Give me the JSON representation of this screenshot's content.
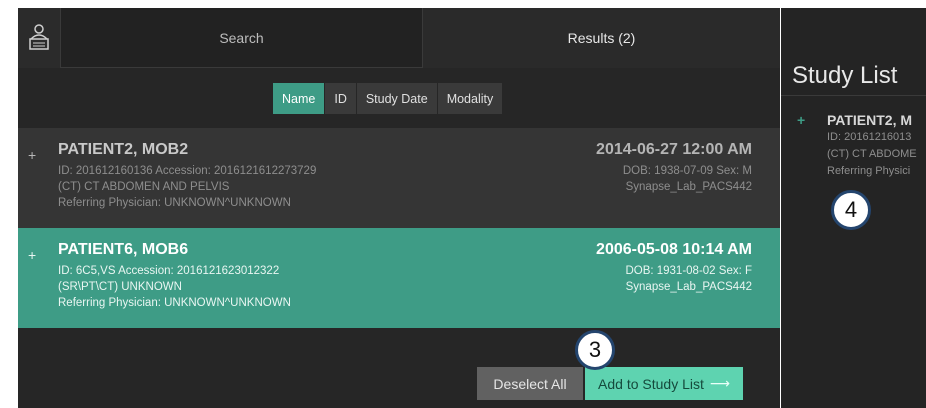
{
  "tabs": {
    "search": "Search",
    "results": "Results (2)"
  },
  "sort": [
    "Name",
    "ID",
    "Study Date",
    "Modality"
  ],
  "results": [
    {
      "plus": "+",
      "name": "PATIENT2, MOB2",
      "id_line": "ID: 201612160136   Accession: 2016121612273729",
      "study": "(CT) CT ABDOMEN AND PELVIS",
      "physician": "Referring Physician: UNKNOWN^UNKNOWN",
      "datetime": "2014-06-27 12:00 AM",
      "dob_sex": "DOB: 1938-07-09 Sex: M",
      "server": "Synapse_Lab_PACS442"
    },
    {
      "plus": "+",
      "name": "PATIENT6, MOB6",
      "id_line": "ID: 6C5,VS   Accession: 2016121623012322",
      "study": "(SR\\PT\\CT) UNKNOWN",
      "physician": "Referring Physician: UNKNOWN^UNKNOWN",
      "datetime": "2006-05-08 10:14 AM",
      "dob_sex": "DOB: 1931-08-02 Sex: F",
      "server": "Synapse_Lab_PACS442"
    }
  ],
  "buttons": {
    "deselect": "Deselect All",
    "add": "Add to Study List",
    "add_arrow": "⟶"
  },
  "callouts": {
    "three": "3",
    "four": "4"
  },
  "study_list": {
    "title": "Study List",
    "plus": "+",
    "name": "PATIENT2, M",
    "id": "ID: 20161216013",
    "study": "(CT) CT ABDOME",
    "physician": "Referring Physici"
  },
  "colors": {
    "accent": "#3e9c86",
    "button_accent": "#5ed3b0",
    "callout_border": "#24456e"
  }
}
